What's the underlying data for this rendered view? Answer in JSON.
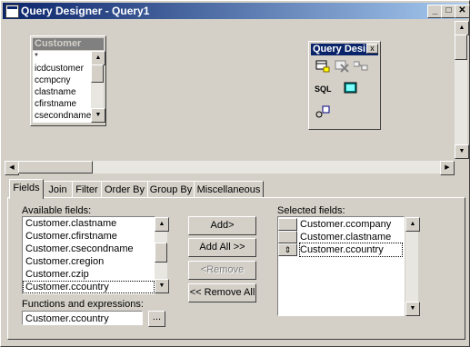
{
  "window": {
    "title": "Query Designer - Query1",
    "controls": {
      "minimize": "_",
      "maximize": "□",
      "close": "✕"
    }
  },
  "customer_table": {
    "title": "Customer",
    "fields": [
      "*",
      "icdcustomer",
      "ccmpcny",
      "clastname",
      "cfirstname",
      "csecondname"
    ]
  },
  "palette": {
    "title": "Query Desi",
    "close": "x",
    "icons": [
      "add-table-icon",
      "remove-table-icon",
      "add-join-icon",
      "sql-icon",
      "output-icon",
      "maximize-icon"
    ],
    "sql_label": "SQL"
  },
  "tabs": [
    {
      "label": "Fields",
      "active": true
    },
    {
      "label": "Join",
      "active": false
    },
    {
      "label": "Filter",
      "active": false
    },
    {
      "label": "Order By",
      "active": false
    },
    {
      "label": "Group By",
      "active": false
    },
    {
      "label": "Miscellaneous",
      "active": false
    }
  ],
  "fields_tab": {
    "available_label": "Available fields:",
    "available": [
      "Customer.clastname",
      "Customer.cfirstname",
      "Customer.csecondname",
      "Customer.cregion",
      "Customer.czip",
      "Customer.ccountry"
    ],
    "available_selected_index": 5,
    "functions_label": "Functions and expressions:",
    "functions_value": "Customer.ccountry",
    "ellipsis": "...",
    "buttons": {
      "add": "Add>",
      "add_all": "Add All >>",
      "remove": "<Remove",
      "remove_all": "<< Remove All"
    },
    "selected_label": "Selected fields:",
    "selected": [
      "Customer.ccompany",
      "Customer.clastname",
      "Customer.ccountry"
    ],
    "selected_focused_index": 2
  }
}
